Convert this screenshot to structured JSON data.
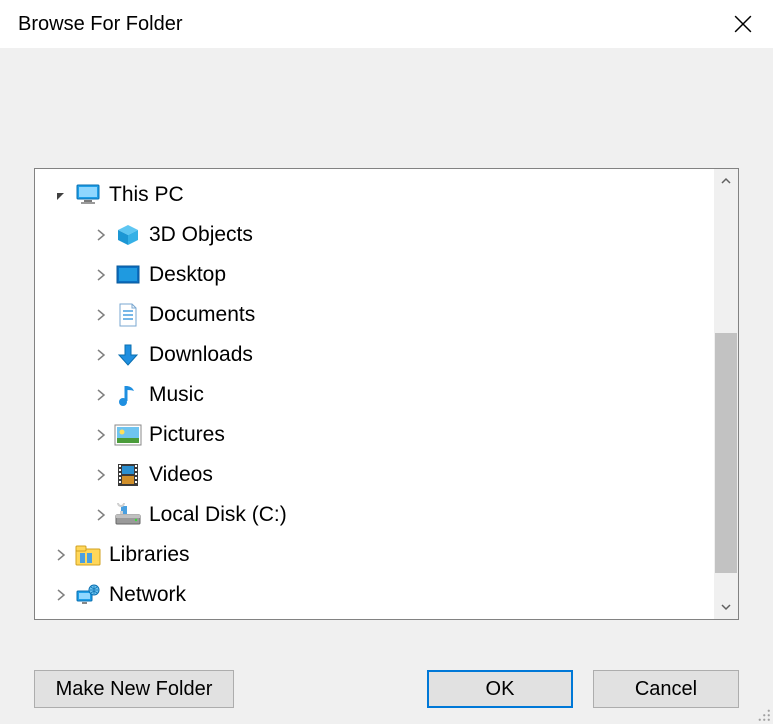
{
  "window": {
    "title": "Browse For Folder"
  },
  "tree": {
    "root": {
      "label": "This PC",
      "expanded": true,
      "children": [
        {
          "id": "3d",
          "label": "3D Objects"
        },
        {
          "id": "desktop",
          "label": "Desktop"
        },
        {
          "id": "documents",
          "label": "Documents"
        },
        {
          "id": "downloads",
          "label": "Downloads"
        },
        {
          "id": "music",
          "label": "Music"
        },
        {
          "id": "pictures",
          "label": "Pictures"
        },
        {
          "id": "videos",
          "label": "Videos"
        },
        {
          "id": "disk_c",
          "label": "Local Disk (C:)"
        }
      ]
    },
    "siblings": [
      {
        "id": "libraries",
        "label": "Libraries"
      },
      {
        "id": "network",
        "label": "Network"
      }
    ]
  },
  "buttons": {
    "make_new": "Make New Folder",
    "ok": "OK",
    "cancel": "Cancel"
  }
}
